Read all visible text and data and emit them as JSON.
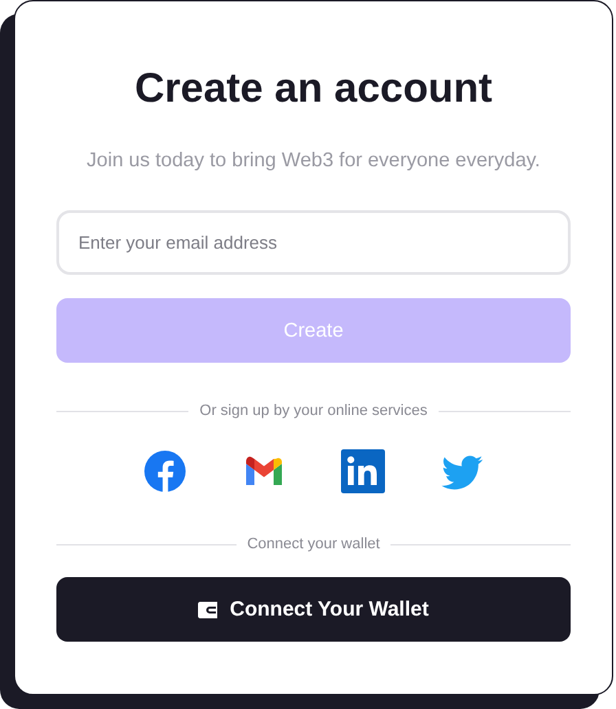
{
  "title": "Create an account",
  "subtitle": "Join us today to bring Web3 for everyone everyday.",
  "email_field": {
    "placeholder": "Enter your email address"
  },
  "create_button": {
    "label": "Create",
    "disabled": true
  },
  "social_divider": "Or sign up by your online services",
  "social_buttons": [
    {
      "kind": "facebook"
    },
    {
      "kind": "gmail"
    },
    {
      "kind": "linkedin"
    },
    {
      "kind": "twitter"
    }
  ],
  "wallet_divider": "Connect your wallet",
  "wallet_button": {
    "label": "Connect Your Wallet"
  }
}
